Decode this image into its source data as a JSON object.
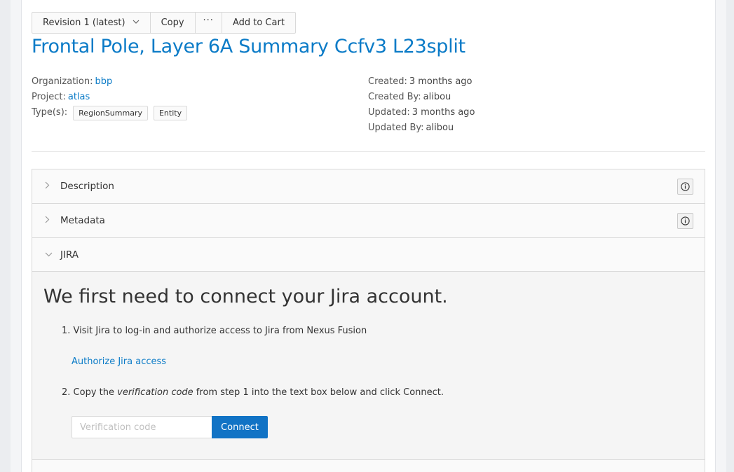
{
  "toolbar": {
    "revision_label": "Revision 1 (latest)",
    "copy_label": "Copy",
    "more_label": "···",
    "add_to_cart_label": "Add to Cart"
  },
  "resource": {
    "title": "Frontal Pole, Layer 6A Summary Ccfv3 L23split",
    "organization_label": "Organization:",
    "organization": "bbp",
    "project_label": "Project:",
    "project": "atlas",
    "types_label": "Type(s):",
    "types": [
      "RegionSummary",
      "Entity"
    ],
    "created_label": "Created:",
    "created": "3 months ago",
    "created_by_label": "Created By:",
    "created_by": "alibou",
    "updated_label": "Updated:",
    "updated": "3 months ago",
    "updated_by_label": "Updated By:",
    "updated_by": "alibou"
  },
  "panels": {
    "description": "Description",
    "metadata": "Metadata",
    "jira": "JIRA"
  },
  "jira": {
    "heading": "We first need to connect your Jira account.",
    "step1": "1. Visit Jira to log-in and authorize access to Jira from Nexus Fusion",
    "authorize_link": "Authorize Jira access",
    "step2_prefix": "2. Copy the ",
    "step2_emph": "verification code",
    "step2_suffix": " from step 1 into the text box below and click Connect.",
    "input_placeholder": "Verification code",
    "connect_label": "Connect"
  },
  "icons": {
    "chevron_down": "chevron-down-icon",
    "chevron_right": "chevron-right-icon",
    "info": "info-icon"
  },
  "colors": {
    "accent": "#0b7bc7",
    "primary_button": "#1173c5"
  }
}
